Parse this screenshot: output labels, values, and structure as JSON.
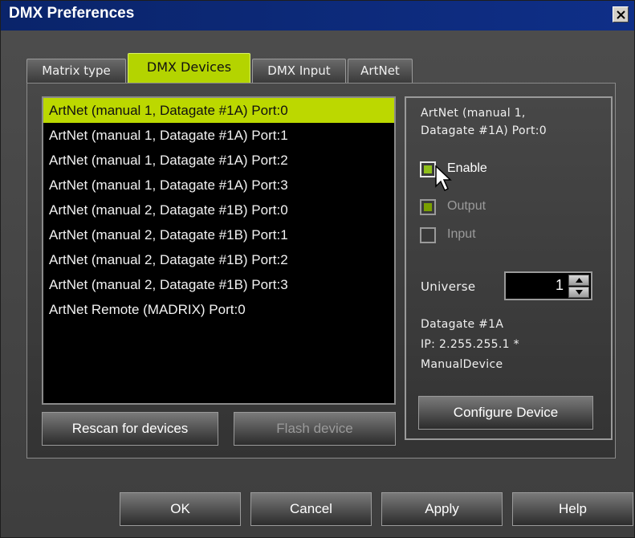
{
  "window": {
    "title": "DMX Preferences"
  },
  "tabs": [
    {
      "label": "Matrix type",
      "active": false
    },
    {
      "label": "DMX Devices",
      "active": true
    },
    {
      "label": "DMX Input",
      "active": false
    },
    {
      "label": "ArtNet",
      "active": false
    }
  ],
  "device_list": {
    "selected_index": 0,
    "items": [
      "ArtNet (manual 1, Datagate #1A) Port:0",
      "ArtNet (manual 1, Datagate #1A) Port:1",
      "ArtNet (manual 1, Datagate #1A) Port:2",
      "ArtNet (manual 1, Datagate #1A) Port:3",
      "ArtNet (manual 2, Datagate #1B) Port:0",
      "ArtNet (manual 2, Datagate #1B) Port:1",
      "ArtNet (manual 2, Datagate #1B) Port:2",
      "ArtNet (manual 2, Datagate #1B) Port:3",
      "ArtNet Remote (MADRIX) Port:0"
    ]
  },
  "list_buttons": {
    "rescan": "Rescan for devices",
    "flash": "Flash device"
  },
  "settings": {
    "device_name_line1": "ArtNet (manual 1,",
    "device_name_line2": "Datagate #1A) Port:0",
    "enable_label": "Enable",
    "enable_checked": true,
    "output_label": "Output",
    "output_checked": true,
    "input_label": "Input",
    "input_checked": false,
    "universe_label": "Universe",
    "universe_value": "1",
    "info_line1": "Datagate #1A",
    "info_line2": "IP: 2.255.255.1 *",
    "info_line3": "ManualDevice",
    "configure_label": "Configure Device"
  },
  "footer_buttons": {
    "ok": "OK",
    "cancel": "Cancel",
    "apply": "Apply",
    "help": "Help"
  },
  "colors": {
    "accent": "#bcd800",
    "titlebar": "#0a246a",
    "list_bg": "#000000"
  }
}
